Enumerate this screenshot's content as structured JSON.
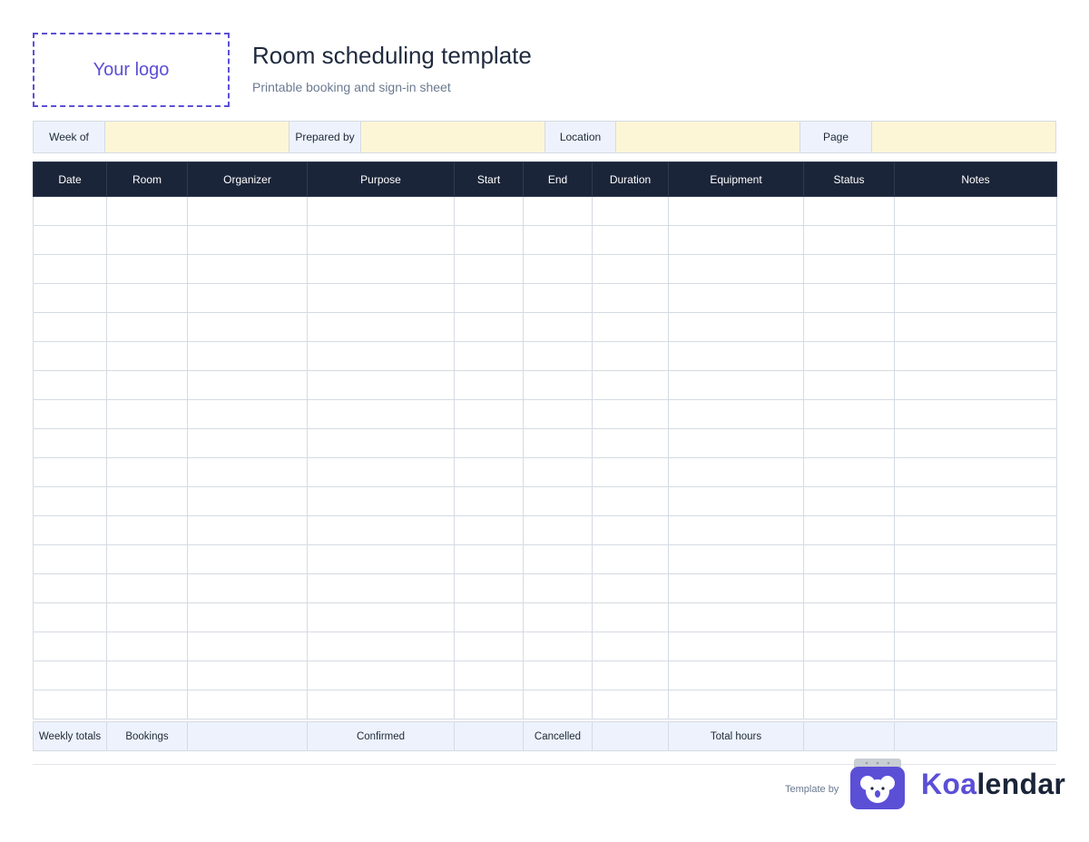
{
  "header": {
    "logo_text": "Your logo",
    "title": "Room scheduling template",
    "subtitle": "Printable booking and sign-in sheet"
  },
  "meta_fields": [
    {
      "label": "Week of",
      "value": ""
    },
    {
      "label": "Prepared by",
      "value": ""
    },
    {
      "label": "Location",
      "value": ""
    },
    {
      "label": "Page",
      "value": ""
    }
  ],
  "table": {
    "columns": [
      "Date",
      "Room",
      "Organizer",
      "Purpose",
      "Start",
      "End",
      "Duration",
      "Equipment",
      "Status",
      "Notes"
    ],
    "row_count": 18
  },
  "totals_row": [
    "Weekly totals",
    "Bookings",
    "",
    "Confirmed",
    "",
    "Cancelled",
    "",
    "Total hours",
    "",
    ""
  ],
  "footer": {
    "template_by": "Template by",
    "brand_part1": "Koa",
    "brand_part2": "lendar"
  },
  "colors": {
    "accent": "#5b4fd6",
    "header_dark": "#1b2539",
    "field_fill": "#fdf6d6",
    "label_fill": "#edf2fc"
  }
}
